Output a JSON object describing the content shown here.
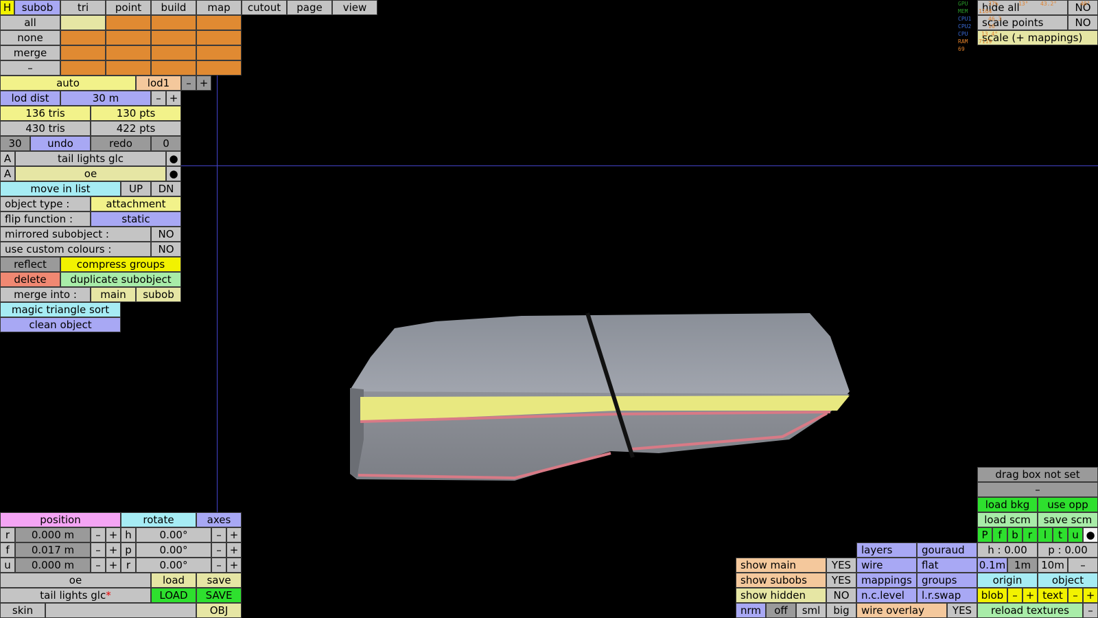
{
  "menu": {
    "h": "H",
    "tabs": [
      "subob",
      "tri",
      "point",
      "build",
      "map",
      "cutout",
      "page",
      "view"
    ]
  },
  "select": {
    "all": "all",
    "none": "none",
    "merge": "merge",
    "minus": "–"
  },
  "lod": {
    "auto": "auto",
    "name": "lod1",
    "minus": "–",
    "plus": "+",
    "dist_label": "lod dist",
    "dist_value": "30 m"
  },
  "stats": {
    "tris1": "136 tris",
    "pts1": "130 pts",
    "tris2": "430 tris",
    "pts2": "422 pts"
  },
  "undo": {
    "count": "30",
    "undo": "undo",
    "redo": "redo",
    "redo_count": "0"
  },
  "objects": [
    {
      "flag": "A",
      "name": "tail lights glc",
      "dot": "●"
    },
    {
      "flag": "A",
      "name": "oe",
      "dot": "●"
    }
  ],
  "list": {
    "move": "move in list",
    "up": "UP",
    "dn": "DN"
  },
  "props": {
    "type_label": "object type :",
    "type_value": "attachment",
    "flip_label": "flip function :",
    "flip_value": "static",
    "mirror_label": "mirrored subobject :",
    "mirror_value": "NO",
    "custom_label": "use custom colours :",
    "custom_value": "NO"
  },
  "actions": {
    "reflect": "reflect",
    "compress": "compress groups",
    "delete": "delete",
    "duplicate": "duplicate subobject",
    "merge_into": "merge into :",
    "main": "main",
    "subob": "subob",
    "magic": "magic triangle sort",
    "clean": "clean object"
  },
  "transform": {
    "position": "position",
    "rotate": "rotate",
    "axes": "axes",
    "rows": [
      {
        "axis": "r",
        "pos": "0.000 m",
        "rot_axis": "h",
        "rot": "0.00°"
      },
      {
        "axis": "f",
        "pos": "0.017 m",
        "rot_axis": "p",
        "rot": "0.00°"
      },
      {
        "axis": "u",
        "pos": "0.000 m",
        "rot_axis": "r",
        "rot": "0.00°"
      }
    ],
    "minus": "–",
    "plus": "+"
  },
  "files": {
    "name1": "oe",
    "load": "load",
    "save": "save",
    "name2": "tail lights glc",
    "star": "*",
    "LOAD": "LOAD",
    "SAVE": "SAVE",
    "skin": "skin",
    "obj": "OBJ"
  },
  "topright": {
    "r1_label": "hide all",
    "r1_value": "NO",
    "r2_label": "scale points",
    "r2_value": "NO",
    "r3_label": "scale (+ mappings)"
  },
  "hud": {
    "labels": [
      "GPU",
      "MEM",
      "CPU1",
      "CPU2",
      "CPU",
      "RAM",
      "69"
    ],
    "gpu": "37%",
    "gpu_t": "13°",
    "gpu_x": "43.2°",
    "gpu_y": "40°",
    "mem": "1164",
    "cpu1": "46.3",
    "cpu2": "16",
    "cpu": "13.4°",
    "ram": "7119"
  },
  "display": {
    "show_main": "show main",
    "show_main_v": "YES",
    "show_subobs": "show subobs",
    "show_subobs_v": "YES",
    "show_hidden": "show hidden",
    "show_hidden_v": "NO",
    "sizes": [
      "nrm",
      "off",
      "sml",
      "big"
    ],
    "layers": "layers",
    "gouraud": "gouraud",
    "wire": "wire",
    "flat": "flat",
    "mappings": "mappings",
    "groups": "groups",
    "nclevel": "n.c.level",
    "lrswap": "l.r.swap",
    "wire_overlay": "wire overlay",
    "wire_overlay_v": "YES"
  },
  "bkg": {
    "drag": "drag box not set",
    "dash": "–",
    "load_bkg": "load bkg",
    "use_opp": "use opp",
    "load_scm": "load scm",
    "save_scm": "save scm",
    "views": [
      "P",
      "f",
      "b",
      "r",
      "l",
      "t",
      "u",
      "●"
    ],
    "h": "h : 0.00",
    "p": "p : 0.00",
    "steps": [
      "0.1m",
      "1m",
      "10m",
      "–"
    ],
    "origin": "origin",
    "object": "object",
    "blob": "blob",
    "minus": "–",
    "plus": "+",
    "text": "text",
    "reload": "reload textures",
    "dash2": "–"
  },
  "colors": {
    "accent_blue": "#a8a8f4",
    "yellow": "#f2f28a",
    "orange": "#e08a32",
    "green": "#2ee02e",
    "crosshair": "#4444cc"
  }
}
